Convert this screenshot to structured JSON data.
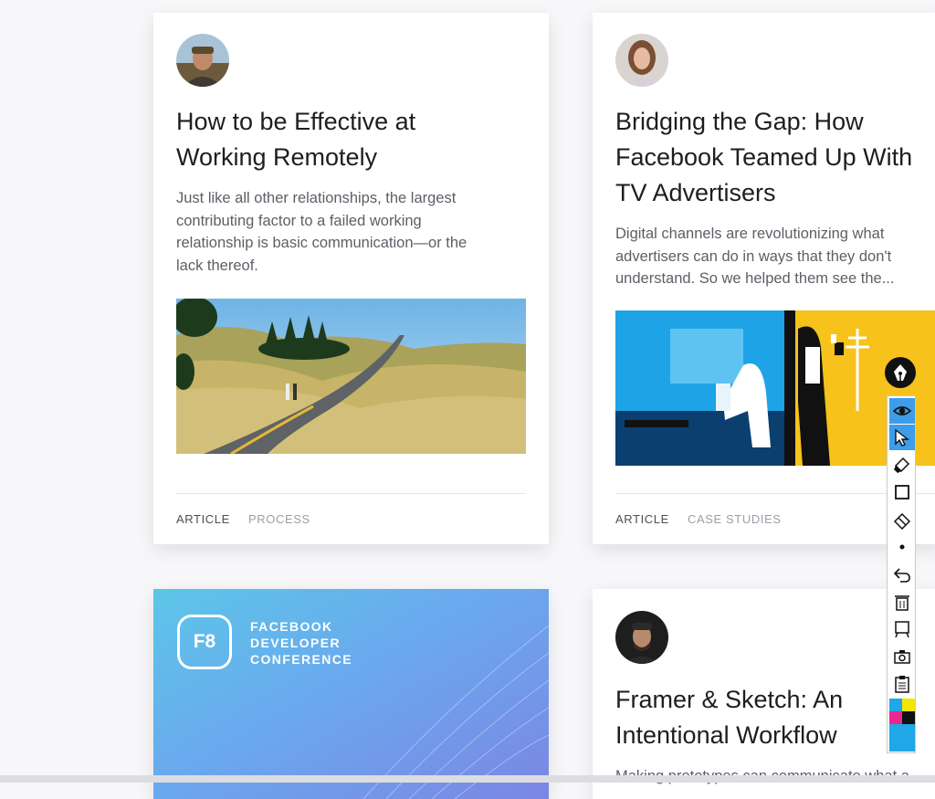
{
  "cards": [
    {
      "title_line1": "How to be Effective at",
      "title_line2": "Working Remotely",
      "excerpt_lines": [
        "Just like all other relationships, the largest",
        "contributing factor to a failed working",
        "relationship is basic communication—or the",
        "lack thereof."
      ],
      "tags": [
        "ARTICLE",
        "PROCESS"
      ]
    },
    {
      "title_lines": [
        "Bridging the Gap: How",
        "Facebook Teamed Up With",
        "TV Advertisers"
      ],
      "excerpt_lines": [
        "Digital channels are revolutionizing what",
        "advertisers can do in ways that they don't",
        "understand. So we helped them see the..."
      ],
      "tags": [
        "ARTICLE",
        "CASE STUDIES"
      ]
    },
    {
      "logo_text": "F8",
      "lines": [
        "FACEBOOK",
        "DEVELOPER",
        "CONFERENCE"
      ]
    },
    {
      "title_lines": [
        "Framer & Sketch: An",
        "Intentional Workflow"
      ],
      "excerpt": "Making prototypes can communicate what a"
    }
  ],
  "toolbar": {
    "tools": [
      "eye-icon",
      "pointer-icon",
      "highlighter-icon",
      "rectangle-icon",
      "eraser-icon",
      "dot-icon",
      "undo-icon",
      "trash-icon",
      "whiteboard-icon",
      "camera-icon",
      "clipboard-icon",
      "color-palette-icon"
    ],
    "active": [
      "eye-icon",
      "pointer-icon"
    ],
    "palette": [
      "#1fa7e8",
      "#f5e600",
      "#e8288f",
      "#111111",
      "#1fa7e8"
    ]
  }
}
